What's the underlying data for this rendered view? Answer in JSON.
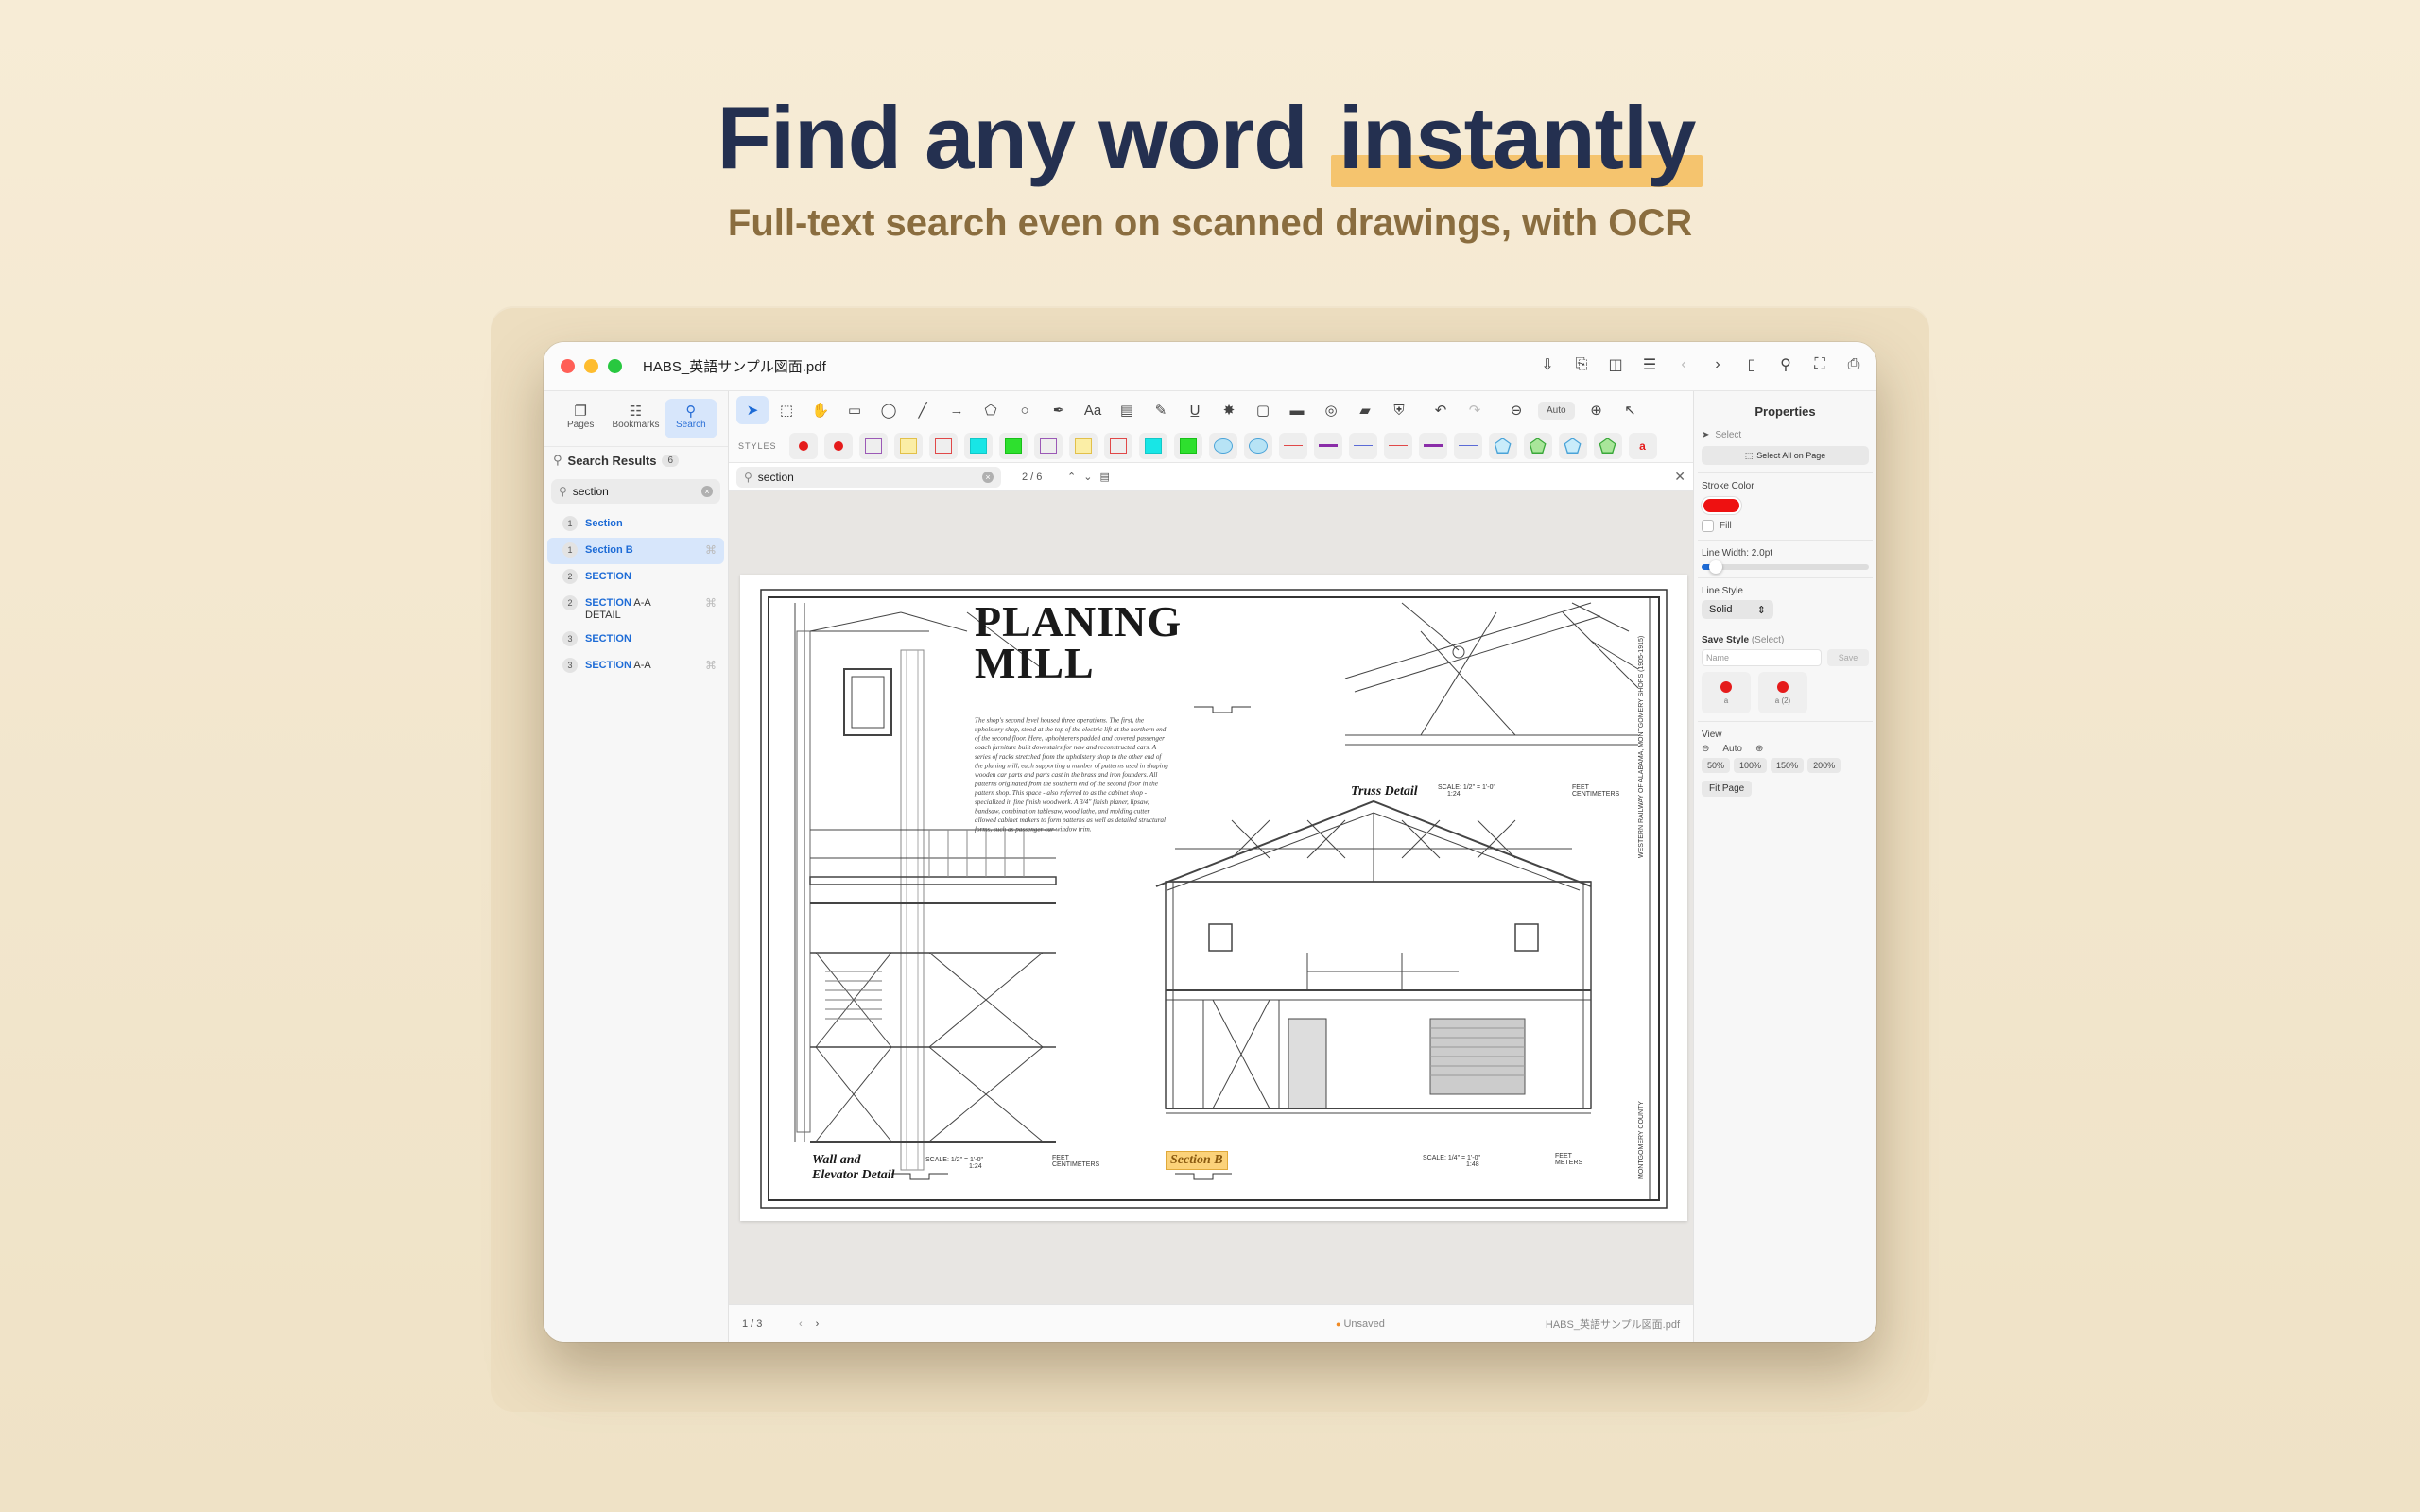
{
  "hero": {
    "title_pre": "Find any word",
    "title_highlight": "instantly",
    "subtitle": "Full-text search even on scanned drawings, with OCR"
  },
  "window": {
    "doc_title": "HABS_英語サンプル図面.pdf"
  },
  "sidebar": {
    "tabs": [
      {
        "label": "Pages",
        "icon": "pages-icon"
      },
      {
        "label": "Bookmarks",
        "icon": "bookmarks-icon"
      },
      {
        "label": "Search",
        "icon": "search-icon",
        "active": true
      }
    ],
    "results_title": "Search Results",
    "results_count": "6",
    "search_value": "section",
    "results": [
      {
        "page": "1",
        "match": "Section",
        "rest": "",
        "selected": false
      },
      {
        "page": "1",
        "match": "Section",
        "rest": " B",
        "selected": true
      },
      {
        "page": "2",
        "match": "SECTION",
        "rest": "",
        "selected": false
      },
      {
        "page": "2",
        "match": "SECTION",
        "rest": " A-A DETAIL",
        "selected": false
      },
      {
        "page": "3",
        "match": "SECTION",
        "rest": "",
        "selected": false
      },
      {
        "page": "3",
        "match": "SECTION",
        "rest": " A-A",
        "selected": false
      }
    ]
  },
  "toolbar": {
    "styles_label": "STYLES",
    "zoom_auto": "Auto",
    "text_tool": "Aa"
  },
  "styles": [
    {
      "kind": "dot",
      "color": "#e51b1b"
    },
    {
      "kind": "dot",
      "color": "#e51b1b"
    },
    {
      "kind": "rect",
      "color": "#9b59b6",
      "fill": "none"
    },
    {
      "kind": "rect",
      "color": "#e2c04a",
      "fill": "#fbeea6"
    },
    {
      "kind": "rect",
      "color": "#e04848",
      "fill": "none"
    },
    {
      "kind": "rect",
      "color": "#12c8c8",
      "fill": "#18e6e6"
    },
    {
      "kind": "rect",
      "color": "#18c018",
      "fill": "#2ee02e"
    },
    {
      "kind": "rect",
      "color": "#9b59b6",
      "fill": "none"
    },
    {
      "kind": "rect",
      "color": "#e2c04a",
      "fill": "#fbeea6"
    },
    {
      "kind": "rect",
      "color": "#e04848",
      "fill": "none"
    },
    {
      "kind": "rect",
      "color": "#12c8c8",
      "fill": "#18e6e6"
    },
    {
      "kind": "rect",
      "color": "#18c018",
      "fill": "#2ee02e"
    },
    {
      "kind": "ellipse",
      "color": "#4aa3d8",
      "fill": "#b7e3f5"
    },
    {
      "kind": "ellipse",
      "color": "#4aa3d8",
      "fill": "#b7e3f5"
    },
    {
      "kind": "line",
      "color": "#e04848",
      "weight": 1
    },
    {
      "kind": "line",
      "color": "#8a2da8",
      "weight": 3
    },
    {
      "kind": "line",
      "color": "#5b6bd6",
      "weight": 1
    },
    {
      "kind": "line",
      "color": "#e04848",
      "weight": 1
    },
    {
      "kind": "line",
      "color": "#8a2da8",
      "weight": 3
    },
    {
      "kind": "line",
      "color": "#5b6bd6",
      "weight": 1
    },
    {
      "kind": "pentagon",
      "color": "#4aa3d8",
      "fill": "#c9ecfa"
    },
    {
      "kind": "pentagon",
      "color": "#3aa83a",
      "fill": "#a9e69a"
    },
    {
      "kind": "pentagon",
      "color": "#4aa3d8",
      "fill": "#c9ecfa"
    },
    {
      "kind": "pentagon",
      "color": "#3aa83a",
      "fill": "#a9e69a"
    },
    {
      "kind": "text",
      "color": "#e51b1b",
      "label": "a"
    }
  ],
  "findbar": {
    "value": "section",
    "count": "2 / 6"
  },
  "drawing": {
    "title_line1": "PLANING",
    "title_line2": "MILL",
    "body": "The shop's second level housed three operations. The first, the upholstery shop, stood at the top of the electric lift at the northern end of the second floor. Here, upholsterers padded and covered passenger coach furniture built downstairs for new and reconstructed cars. A series of racks stretched from the upholstery shop to the other end of the planing mill, each supporting a number of patterns used in shaping wooden car parts and parts cast in the brass and iron founders. All patterns originated from the southern end of the second floor in the pattern shop. This space - also referred to as the cabinet shop - specialized in fine finish woodwork. A 3/4\" finish planer, lipsaw, bandsaw, combination tablesaw, wood lathe, and molding cutter allowed cabinet makers to form patterns as well as detailed structural forms, such as passenger car window trim.",
    "truss_label": "Truss Detail",
    "truss_scale": "SCALE: 1/2\" = 1'-0\"",
    "truss_ratio": "1:24",
    "wall_label_1": "Wall and",
    "wall_label_2": "Elevator Detail",
    "wall_scale": "SCALE: 1/2\" = 1'-0\"",
    "wall_ratio": "1:24",
    "section_label": "Section B",
    "section_scale": "SCALE: 1/4\" = 1'-0\"",
    "section_ratio": "1:48",
    "unit_feet": "FEET",
    "unit_cm": "CENTIMETERS",
    "unit_meters": "METERS",
    "side_text_1": "WESTERN RAILWAY OF ALABAMA, MONTGOMERY SHOPS (1905-1915)",
    "side_text_2": "MONTGOMERY COUNTY"
  },
  "status": {
    "page": "1 / 3",
    "unsaved": "Unsaved",
    "file": "HABS_英語サンプル図面.pdf"
  },
  "properties": {
    "title": "Properties",
    "select_label": "Select",
    "select_all": "Select All on Page",
    "stroke_color_label": "Stroke Color",
    "stroke_color": "#ee1111",
    "fill_label": "Fill",
    "line_width_label": "Line Width: 2.0pt",
    "line_style_label": "Line Style",
    "line_style_value": "Solid",
    "save_style_label": "Save Style",
    "save_style_hint": "(Select)",
    "name_placeholder": "Name",
    "save_button": "Save",
    "saved_styles": [
      {
        "label": "a"
      },
      {
        "label": "a (2)"
      }
    ],
    "view_label": "View",
    "view_auto": "Auto",
    "zoom_presets": [
      "50%",
      "100%",
      "150%",
      "200%"
    ],
    "fit_page": "Fit Page"
  }
}
